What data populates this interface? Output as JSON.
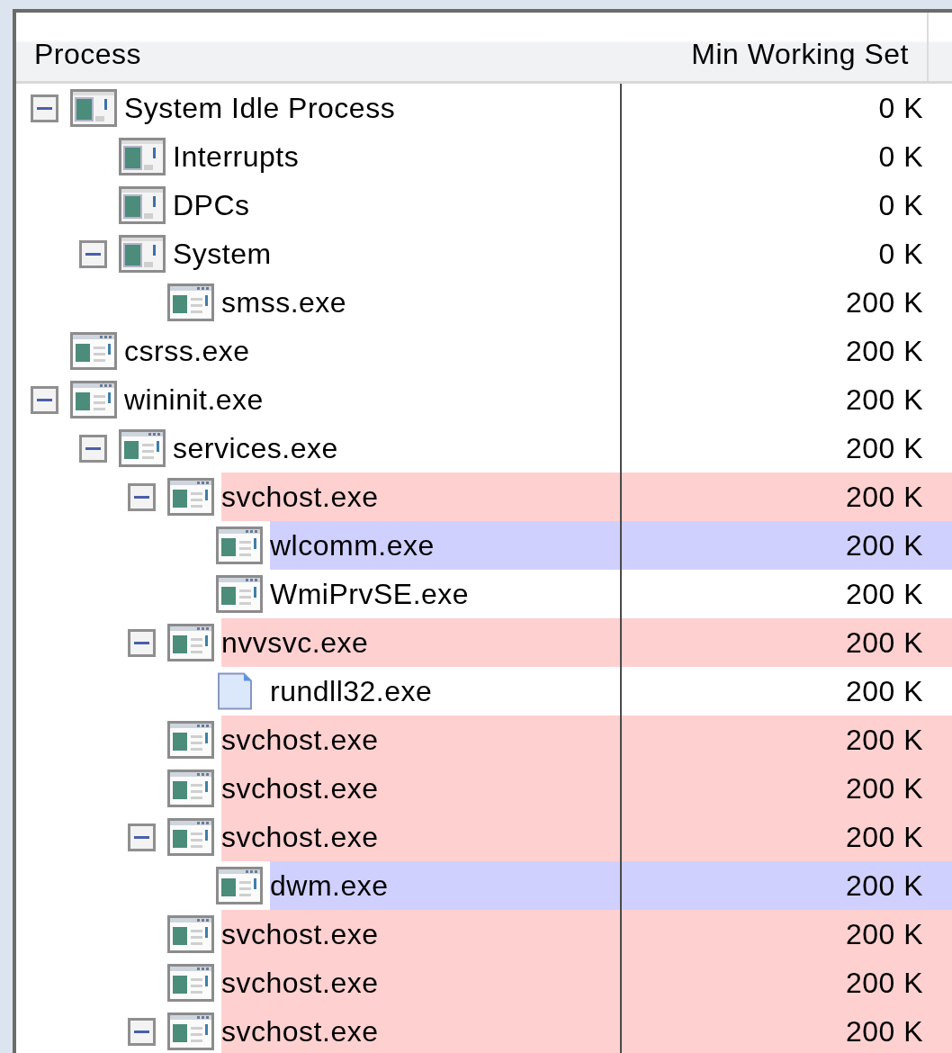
{
  "columns": [
    "Process",
    "Min Working Set"
  ],
  "processes": [
    {
      "name": "System Idle Process",
      "value": "0 K",
      "kind": "system",
      "expanded": true,
      "children": [
        {
          "name": "Interrupts",
          "value": "0 K",
          "kind": "system"
        },
        {
          "name": "DPCs",
          "value": "0 K",
          "kind": "system"
        },
        {
          "name": "System",
          "value": "0 K",
          "kind": "system",
          "expanded": true,
          "children": [
            {
              "name": "smss.exe",
              "value": "200 K",
              "kind": "app"
            }
          ]
        }
      ]
    },
    {
      "name": "csrss.exe",
      "value": "200 K",
      "kind": "app"
    },
    {
      "name": "wininit.exe",
      "value": "200 K",
      "kind": "app",
      "expanded": true,
      "children": [
        {
          "name": "services.exe",
          "value": "200 K",
          "kind": "app",
          "expanded": true,
          "children": [
            {
              "name": "svchost.exe",
              "value": "200 K",
              "kind": "app",
              "color": "#ffd0d0",
              "expanded": true,
              "children": [
                {
                  "name": "wlcomm.exe",
                  "value": "200 K",
                  "kind": "app",
                  "color": "#d0d0ff"
                },
                {
                  "name": "WmiPrvSE.exe",
                  "value": "200 K",
                  "kind": "app"
                }
              ]
            },
            {
              "name": "nvvsvc.exe",
              "value": "200 K",
              "kind": "app",
              "color": "#ffd0d0",
              "expanded": true,
              "children": [
                {
                  "name": "rundll32.exe",
                  "value": "200 K",
                  "kind": "file"
                }
              ]
            },
            {
              "name": "svchost.exe",
              "value": "200 K",
              "kind": "app",
              "color": "#ffd0d0"
            },
            {
              "name": "svchost.exe",
              "value": "200 K",
              "kind": "app",
              "color": "#ffd0d0"
            },
            {
              "name": "svchost.exe",
              "value": "200 K",
              "kind": "app",
              "color": "#ffd0d0",
              "expanded": true,
              "children": [
                {
                  "name": "dwm.exe",
                  "value": "200 K",
                  "kind": "app",
                  "color": "#d0d0ff"
                }
              ]
            },
            {
              "name": "svchost.exe",
              "value": "200 K",
              "kind": "app",
              "color": "#ffd0d0"
            },
            {
              "name": "svchost.exe",
              "value": "200 K",
              "kind": "app",
              "color": "#ffd0d0"
            },
            {
              "name": "svchost.exe",
              "value": "200 K",
              "kind": "app",
              "color": "#ffd0d0",
              "expanded": true
            }
          ]
        }
      ]
    }
  ]
}
